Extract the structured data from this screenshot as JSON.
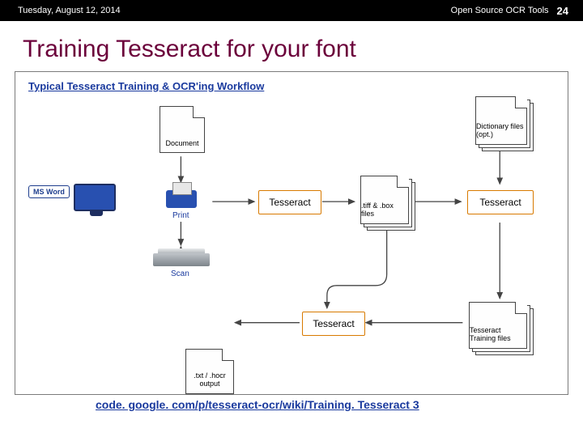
{
  "header": {
    "date": "Tuesday, August 12, 2014",
    "topic": "Open Source OCR Tools",
    "page": "24"
  },
  "title": "Training Tesseract for your font",
  "diagram": {
    "heading": "Typical Tesseract Training & OCR'ing Workflow",
    "nodes": {
      "msword": "MS Word",
      "document": "Document",
      "print": "Print",
      "scan": "Scan",
      "tesseract1": "Tesseract",
      "tesseract2": "Tesseract",
      "tesseract3": "Tesseract",
      "tiffbox": ".tiff & .box files",
      "dictfiles": "Dictionary files (opt.)",
      "trainfiles": "Tesseract Training files",
      "output": ".txt / .hocr output"
    }
  },
  "link": "code. google. com/p/tesseract-ocr/wiki/Training. Tesseract 3"
}
